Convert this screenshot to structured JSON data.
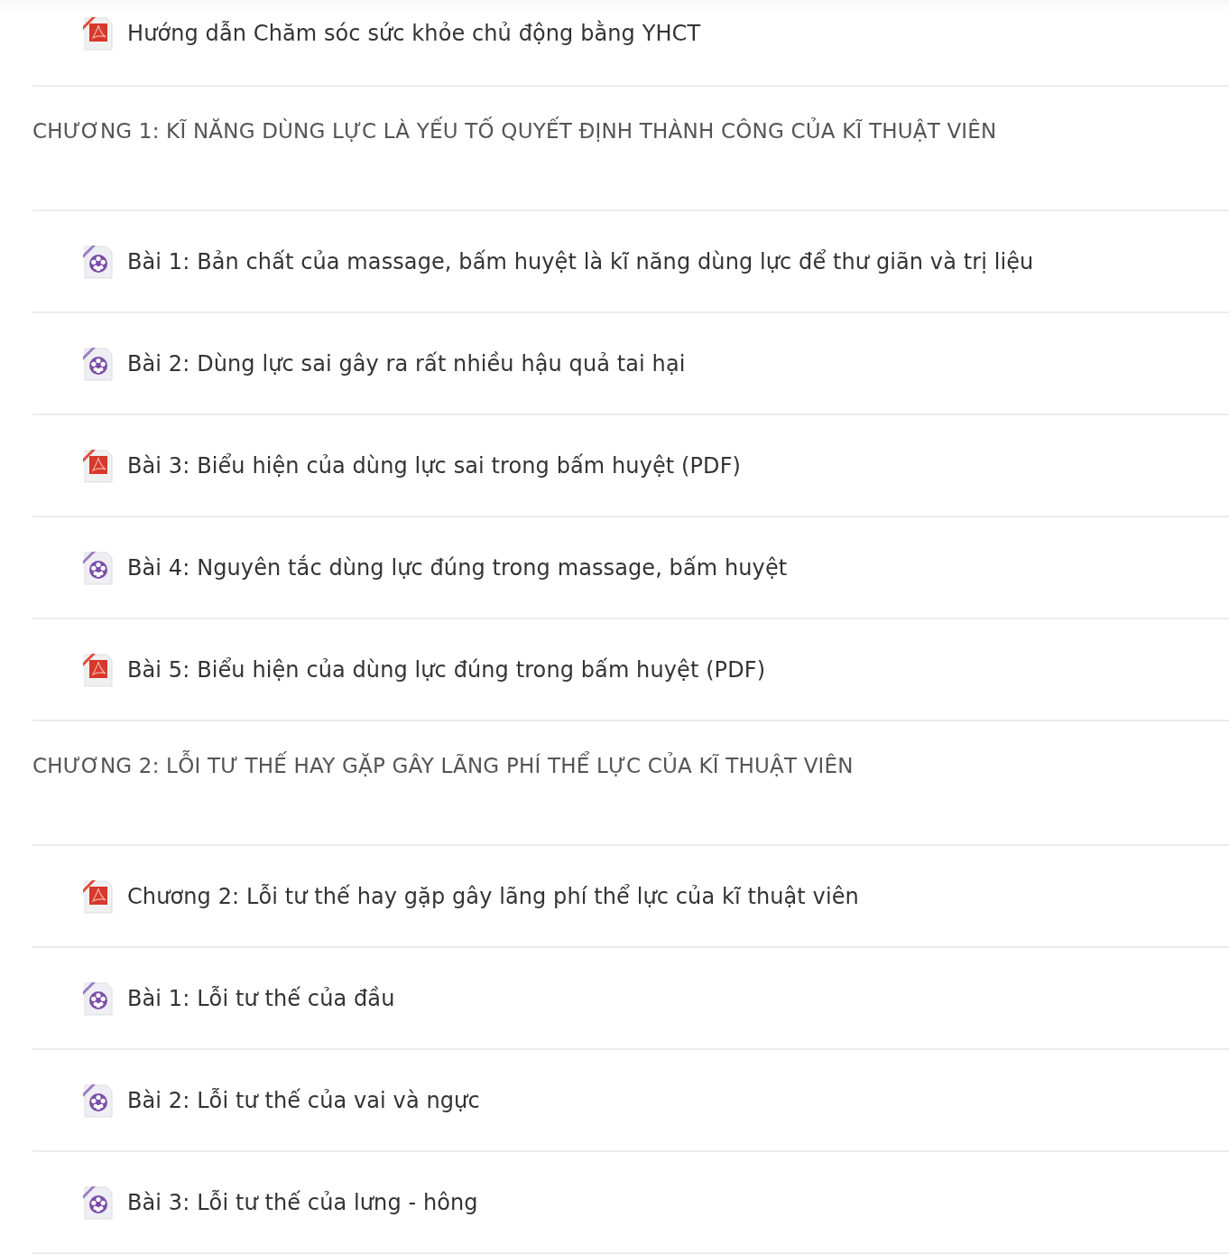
{
  "items": [
    {
      "kind": "pdf",
      "title": "Hướng dẫn Chăm sóc sức khỏe chủ động bằng YHCT"
    },
    {
      "kind": "chapter",
      "title": "CHƯƠNG 1: KĨ NĂNG DÙNG LỰC LÀ YẾU TỐ QUYẾT ĐỊNH THÀNH CÔNG CỦA KĨ THUẬT VIÊN"
    },
    {
      "kind": "video",
      "title": "Bài 1: Bản chất của massage, bấm huyệt là kĩ năng dùng lực để thư giãn và trị liệu"
    },
    {
      "kind": "video",
      "title": "Bài 2: Dùng lực sai gây ra rất nhiều hậu quả tai hại"
    },
    {
      "kind": "pdf",
      "title": "Bài 3: Biểu hiện của dùng lực sai trong bấm huyệt (PDF)"
    },
    {
      "kind": "video",
      "title": "Bài 4: Nguyên tắc dùng lực đúng trong massage, bấm huyệt"
    },
    {
      "kind": "pdf",
      "title": "Bài 5: Biểu hiện của dùng lực đúng trong bấm huyệt (PDF)"
    },
    {
      "kind": "chapter",
      "title": "CHƯƠNG 2: LỖI TƯ THẾ HAY GẶP GÂY LÃNG PHÍ THỂ LỰC CỦA KĨ THUẬT VIÊN"
    },
    {
      "kind": "pdf",
      "title": "Chương 2: Lỗi tư thế hay gặp gây lãng phí thể lực của kĩ thuật viên"
    },
    {
      "kind": "video",
      "title": "Bài 1: Lỗi tư thế của đầu"
    },
    {
      "kind": "video",
      "title": "Bài 2: Lỗi tư thế của vai và ngực"
    },
    {
      "kind": "video",
      "title": "Bài 3: Lỗi tư thế của lưng - hông"
    }
  ]
}
